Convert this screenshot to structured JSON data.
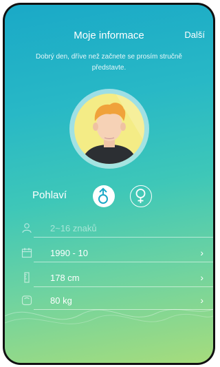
{
  "header": {
    "title": "Moje informace",
    "next_label": "Další"
  },
  "intro": "Dobrý den, dříve než začnete se prosím stručně představte.",
  "gender": {
    "label": "Pohlaví",
    "selected": "male"
  },
  "fields": [
    {
      "id": "name",
      "icon": "person-icon",
      "value": "",
      "placeholder": "2~16 znaků",
      "chevron": false
    },
    {
      "id": "birth",
      "icon": "calendar-icon",
      "value": "1990 - 10",
      "placeholder": "",
      "chevron": true
    },
    {
      "id": "height",
      "icon": "ruler-icon",
      "value": "178 cm",
      "placeholder": "",
      "chevron": true
    },
    {
      "id": "weight",
      "icon": "scale-icon",
      "value": "80 kg",
      "placeholder": "",
      "chevron": true
    }
  ],
  "colors": {
    "accent": "#1aa9c7",
    "avatar_bg": "#f4ec86"
  }
}
